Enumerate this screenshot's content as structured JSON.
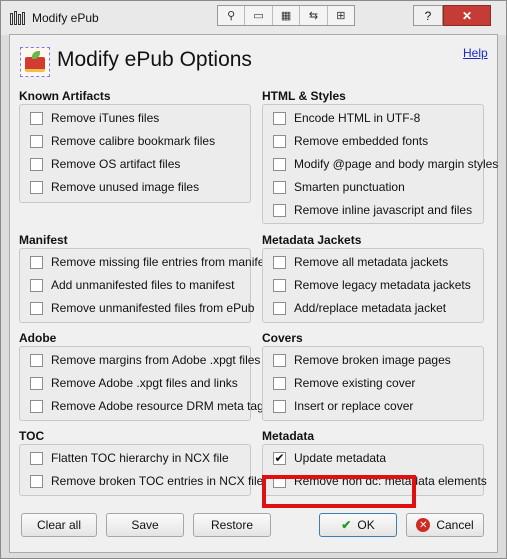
{
  "window": {
    "title": "Modify ePub",
    "toolbar": [
      "⚲",
      "▭",
      "▦",
      "⇆",
      "⊞"
    ],
    "help_button": "?",
    "close_button": "✕"
  },
  "header": {
    "title": "Modify ePub Options",
    "help_link": "Help"
  },
  "sections": {
    "known": {
      "title": "Known Artifacts",
      "options": [
        {
          "label": "Remove iTunes files",
          "checked": false
        },
        {
          "label": "Remove calibre bookmark files",
          "checked": false
        },
        {
          "label": "Remove OS artifact files",
          "checked": false
        },
        {
          "label": "Remove unused image files",
          "checked": false
        }
      ]
    },
    "html": {
      "title": "HTML & Styles",
      "options": [
        {
          "label": "Encode HTML in UTF-8",
          "checked": false
        },
        {
          "label": "Remove embedded fonts",
          "checked": false
        },
        {
          "label": "Modify @page and body margin styles",
          "checked": false
        },
        {
          "label": "Smarten punctuation",
          "checked": false
        },
        {
          "label": "Remove inline javascript and files",
          "checked": false
        }
      ]
    },
    "manifest": {
      "title": "Manifest",
      "options": [
        {
          "label": "Remove missing file entries from manifest",
          "checked": false
        },
        {
          "label": "Add unmanifested files to manifest",
          "checked": false
        },
        {
          "label": "Remove unmanifested files from ePub",
          "checked": false
        }
      ]
    },
    "jackets": {
      "title": "Metadata Jackets",
      "options": [
        {
          "label": "Remove all metadata jackets",
          "checked": false
        },
        {
          "label": "Remove legacy metadata jackets",
          "checked": false
        },
        {
          "label": "Add/replace metadata jacket",
          "checked": false
        }
      ]
    },
    "adobe": {
      "title": "Adobe",
      "options": [
        {
          "label": "Remove margins from Adobe .xpgt files",
          "checked": false
        },
        {
          "label": "Remove Adobe .xpgt files and links",
          "checked": false
        },
        {
          "label": "Remove Adobe resource DRM meta tags",
          "checked": false
        }
      ]
    },
    "covers": {
      "title": "Covers",
      "options": [
        {
          "label": "Remove broken image pages",
          "checked": false
        },
        {
          "label": "Remove existing cover",
          "checked": false
        },
        {
          "label": "Insert or replace cover",
          "checked": false
        }
      ]
    },
    "toc": {
      "title": "TOC",
      "options": [
        {
          "label": "Flatten TOC hierarchy in NCX file",
          "checked": false
        },
        {
          "label": "Remove broken TOC entries in NCX file",
          "checked": false
        }
      ]
    },
    "metadata": {
      "title": "Metadata",
      "options": [
        {
          "label": "Update metadata",
          "checked": true
        },
        {
          "label": "Remove non dc: metadata elements",
          "checked": false
        }
      ]
    }
  },
  "buttons": {
    "clear_all": "Clear all",
    "save": "Save",
    "restore": "Restore",
    "ok": "OK",
    "cancel": "Cancel"
  },
  "colors": {
    "highlight": "#e01010",
    "link": "#1a28c9",
    "ok_check": "#1e9a2c",
    "cancel_icon": "#d02b20"
  }
}
